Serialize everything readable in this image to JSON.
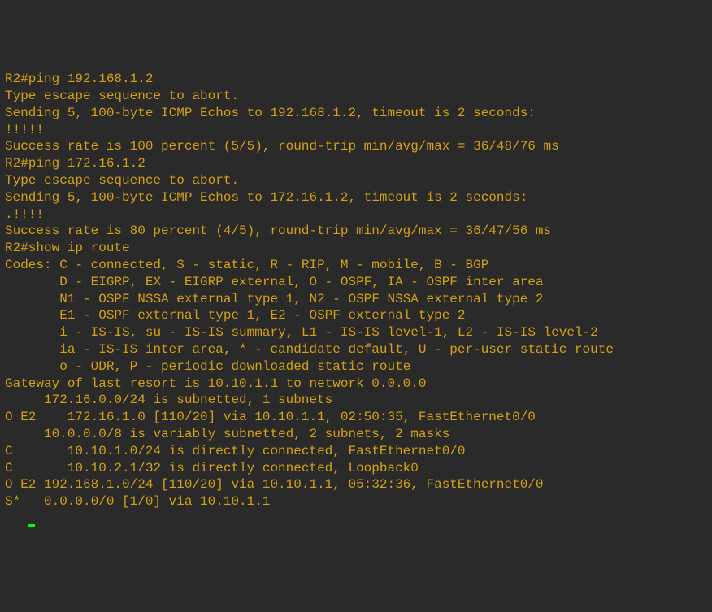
{
  "lines": [
    "R2#ping 192.168.1.2",
    "",
    "Type escape sequence to abort.",
    "Sending 5, 100-byte ICMP Echos to 192.168.1.2, timeout is 2 seconds:",
    "!!!!!",
    "Success rate is 100 percent (5/5), round-trip min/avg/max = 36/48/76 ms",
    "R2#ping 172.16.1.2",
    "",
    "Type escape sequence to abort.",
    "Sending 5, 100-byte ICMP Echos to 172.16.1.2, timeout is 2 seconds:",
    ".!!!!",
    "Success rate is 80 percent (4/5), round-trip min/avg/max = 36/47/56 ms",
    "R2#show ip route",
    "Codes: C - connected, S - static, R - RIP, M - mobile, B - BGP",
    "       D - EIGRP, EX - EIGRP external, O - OSPF, IA - OSPF inter area",
    "       N1 - OSPF NSSA external type 1, N2 - OSPF NSSA external type 2",
    "       E1 - OSPF external type 1, E2 - OSPF external type 2",
    "       i - IS-IS, su - IS-IS summary, L1 - IS-IS level-1, L2 - IS-IS level-2",
    "       ia - IS-IS inter area, * - candidate default, U - per-user static route",
    "       o - ODR, P - periodic downloaded static route",
    "",
    "Gateway of last resort is 10.10.1.1 to network 0.0.0.0",
    "",
    "     172.16.0.0/24 is subnetted, 1 subnets",
    "O E2    172.16.1.0 [110/20] via 10.10.1.1, 02:50:35, FastEthernet0/0",
    "     10.0.0.0/8 is variably subnetted, 2 subnets, 2 masks",
    "C       10.10.1.0/24 is directly connected, FastEthernet0/0",
    "C       10.10.2.1/32 is directly connected, Loopback0",
    "O E2 192.168.1.0/24 [110/20] via 10.10.1.1, 05:32:36, FastEthernet0/0",
    "S*   0.0.0.0/0 [1/0] via 10.10.1.1"
  ]
}
